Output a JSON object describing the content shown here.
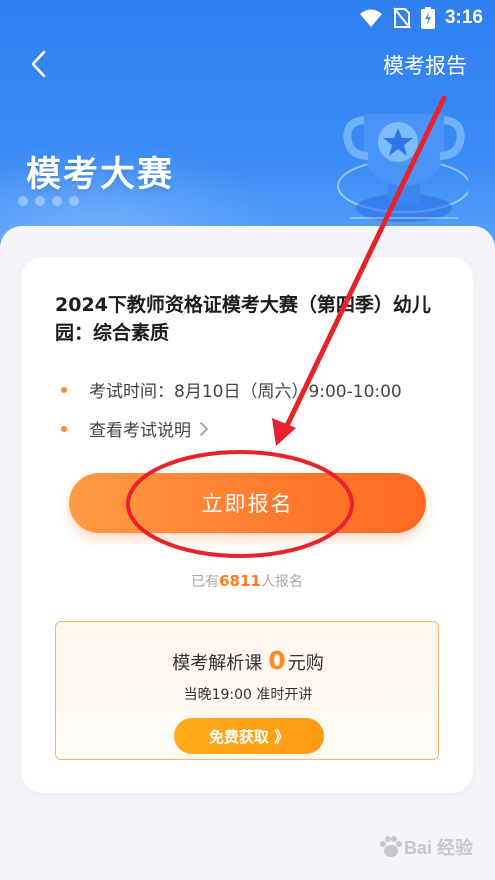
{
  "status_bar": {
    "time": "3:16"
  },
  "header": {
    "title": "模考大赛",
    "report_link": "模考报告"
  },
  "exam": {
    "title": "2024下教师资格证模考大赛（第四季）幼儿园：综合素质",
    "time_label": "考试时间：",
    "time_value": "8月10日（周六）9:00-10:00",
    "description_link": "查看考试说明"
  },
  "signup": {
    "button_label": "立即报名",
    "count_prefix": "已有",
    "count": "6811",
    "count_suffix": "人报名"
  },
  "promo": {
    "line1_prefix": "模考解析课",
    "price": "0",
    "line1_suffix": "元购",
    "line2": "当晚19:00  准时开讲",
    "button_label": "免费获取 》"
  },
  "colors": {
    "header_blue": "#2f7ff0",
    "accent_orange": "#ff7a2c",
    "promo_gold": "#ffab1a"
  },
  "watermark": "Bai 经验"
}
